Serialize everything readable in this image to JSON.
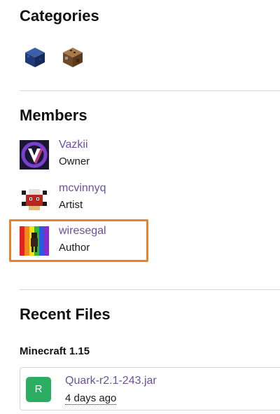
{
  "categories": {
    "title": "Categories",
    "items": [
      {
        "icon": "blue-cube-icon"
      },
      {
        "icon": "crafting-table-icon"
      }
    ]
  },
  "members": {
    "title": "Members",
    "items": [
      {
        "name": "Vazkii",
        "role": "Owner",
        "avatar": "vazkii-avatar"
      },
      {
        "name": "mcvinnyq",
        "role": "Artist",
        "avatar": "mcvinnyq-avatar"
      },
      {
        "name": "wiresegal",
        "role": "Author",
        "avatar": "wiresegal-avatar"
      }
    ]
  },
  "recent_files": {
    "title": "Recent Files",
    "version": "Minecraft 1.15",
    "file": {
      "badge": "R",
      "name": "Quark-r2.1-243.jar",
      "date": "4 days ago"
    }
  },
  "colors": {
    "link": "#6b4fa0",
    "highlight": "#f07f2a",
    "release_badge": "#2cae62"
  }
}
